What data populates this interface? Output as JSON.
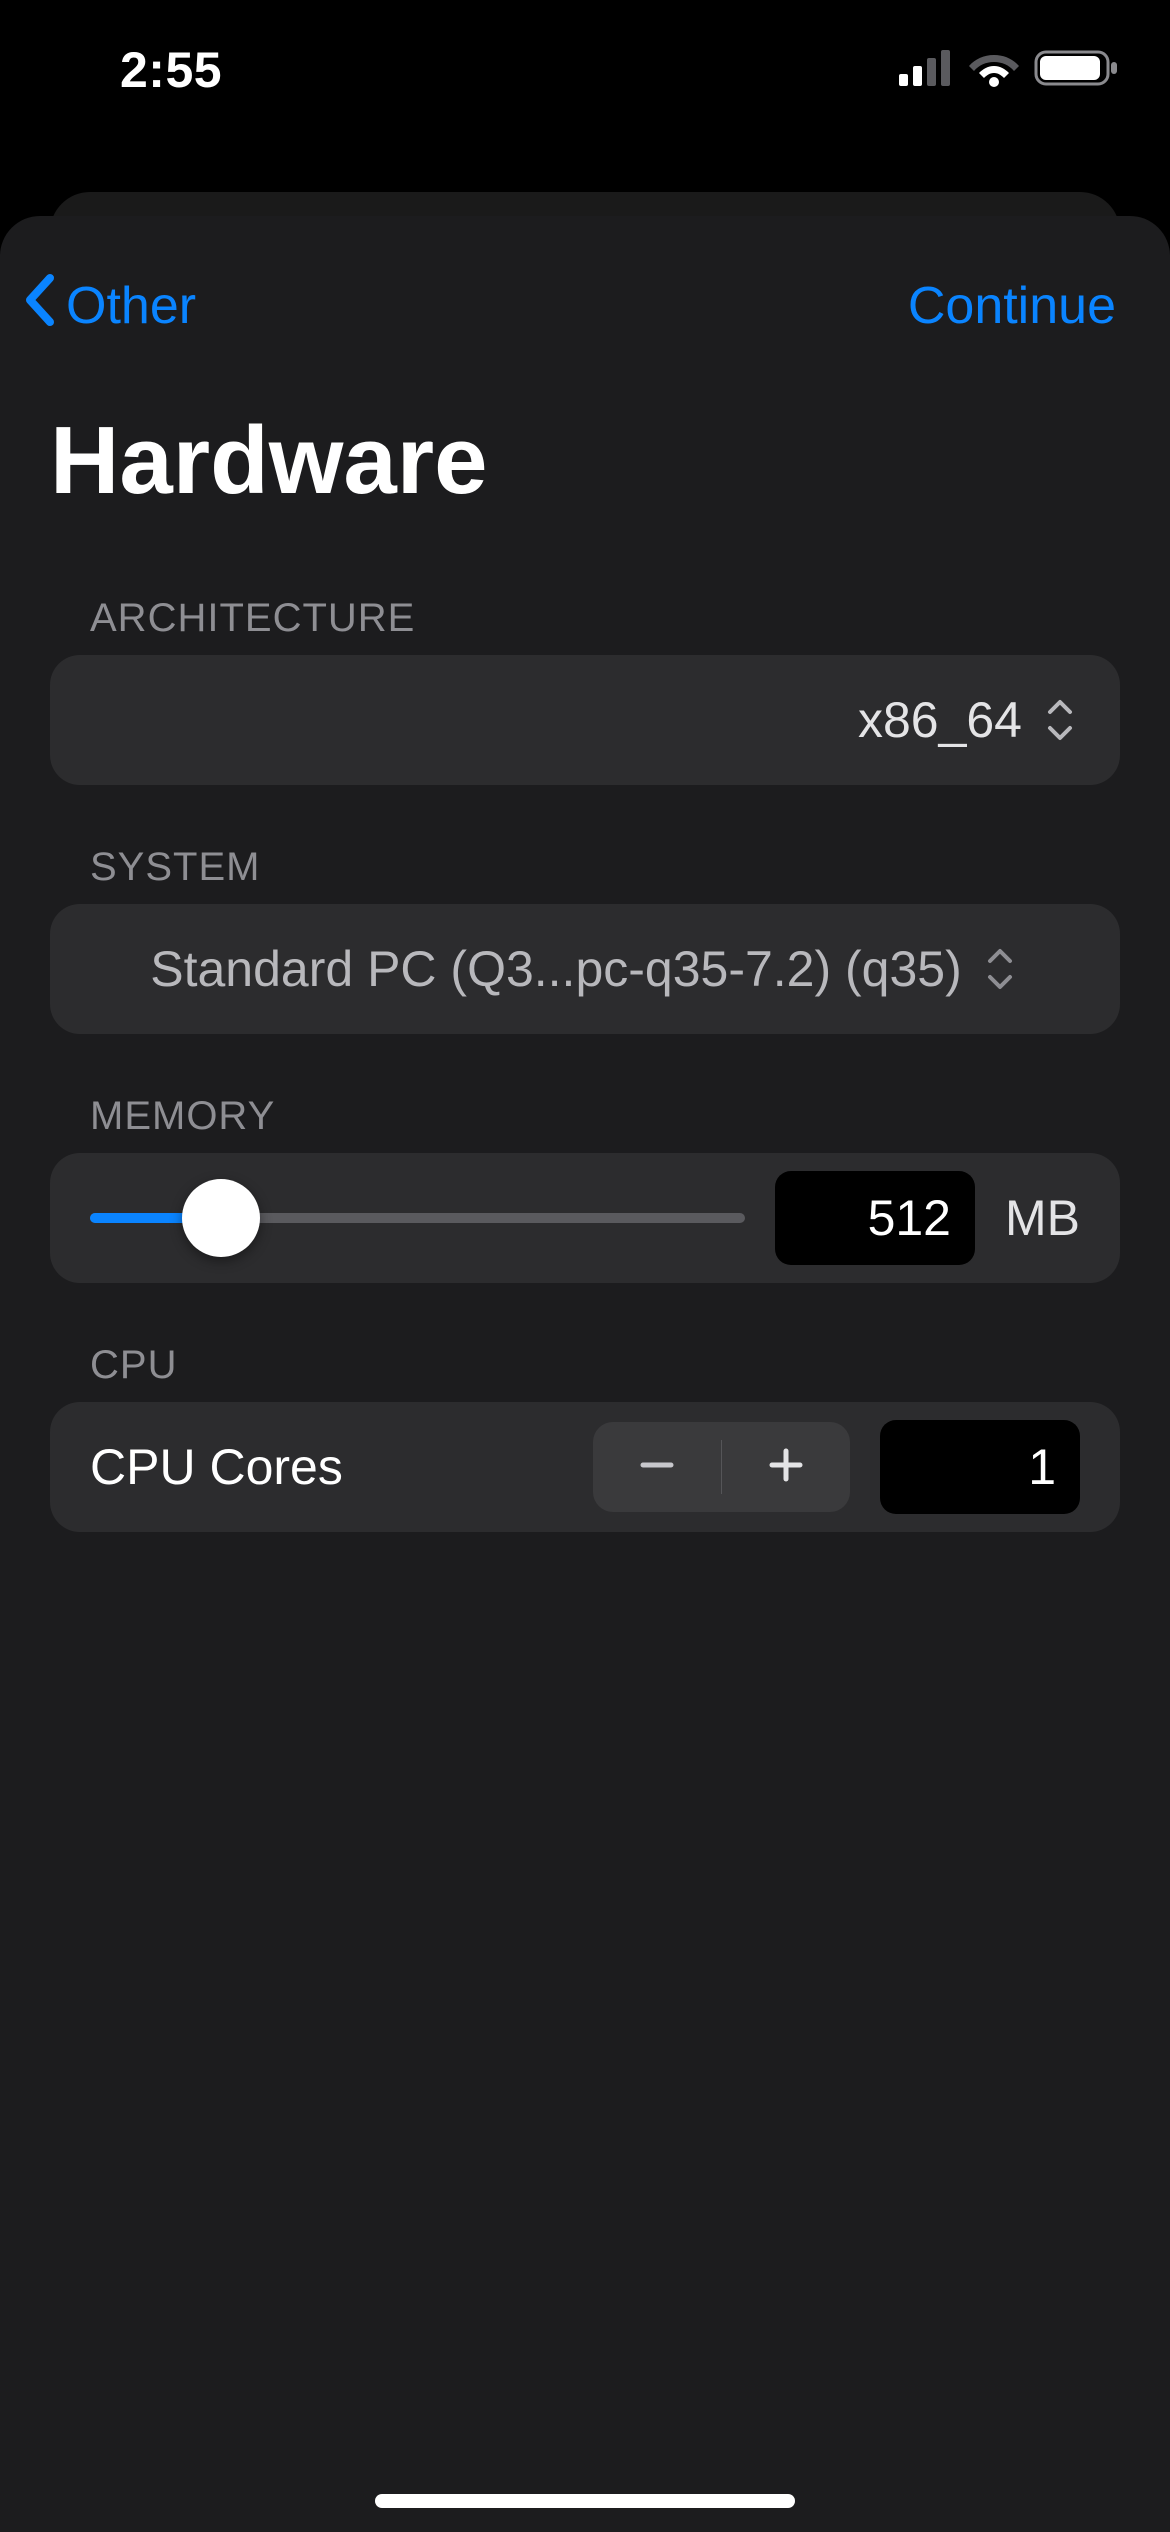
{
  "status": {
    "time": "2:55"
  },
  "nav": {
    "back_label": "Other",
    "continue_label": "Continue"
  },
  "title": "Hardware",
  "sections": {
    "architecture": {
      "header": "ARCHITECTURE",
      "value": "x86_64"
    },
    "system": {
      "header": "SYSTEM",
      "value": "Standard PC (Q3...pc-q35-7.2) (q35)"
    },
    "memory": {
      "header": "MEMORY",
      "value": "512",
      "unit": "MB"
    },
    "cpu": {
      "header": "CPU",
      "label": "CPU Cores",
      "value": "1"
    }
  }
}
